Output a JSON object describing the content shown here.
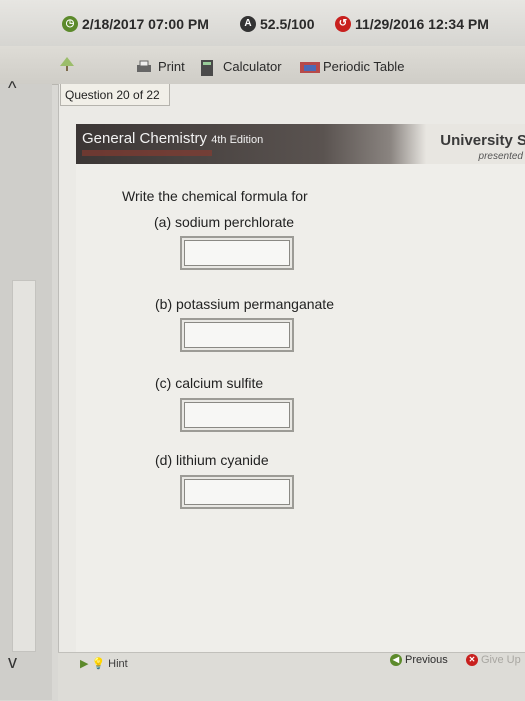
{
  "status": {
    "due_date": "2/18/2017 07:00 PM",
    "score": "52.5/100",
    "submitted_date": "11/29/2016 12:34 PM"
  },
  "toolbar": {
    "print": "Print",
    "calculator": "Calculator",
    "periodic_table": "Periodic Table"
  },
  "question_counter": "Question 20 of 22",
  "banner": {
    "title": "General Chemistry",
    "edition": "4th Edition",
    "university": "University S",
    "presented": "presented"
  },
  "question": {
    "prompt": "Write the chemical formula for",
    "parts": [
      {
        "label": "(a) sodium perchlorate",
        "value": ""
      },
      {
        "label": "(b) potassium permanganate",
        "value": ""
      },
      {
        "label": "(c) calcium sulfite",
        "value": ""
      },
      {
        "label": "(d) lithium cyanide",
        "value": ""
      }
    ]
  },
  "footer": {
    "hint": "Hint",
    "previous": "Previous",
    "give_up": "Give Up"
  },
  "colors": {
    "green_icon": "#5c8a2b",
    "red_icon": "#c8201e",
    "banner_dark": "#3b3635"
  }
}
